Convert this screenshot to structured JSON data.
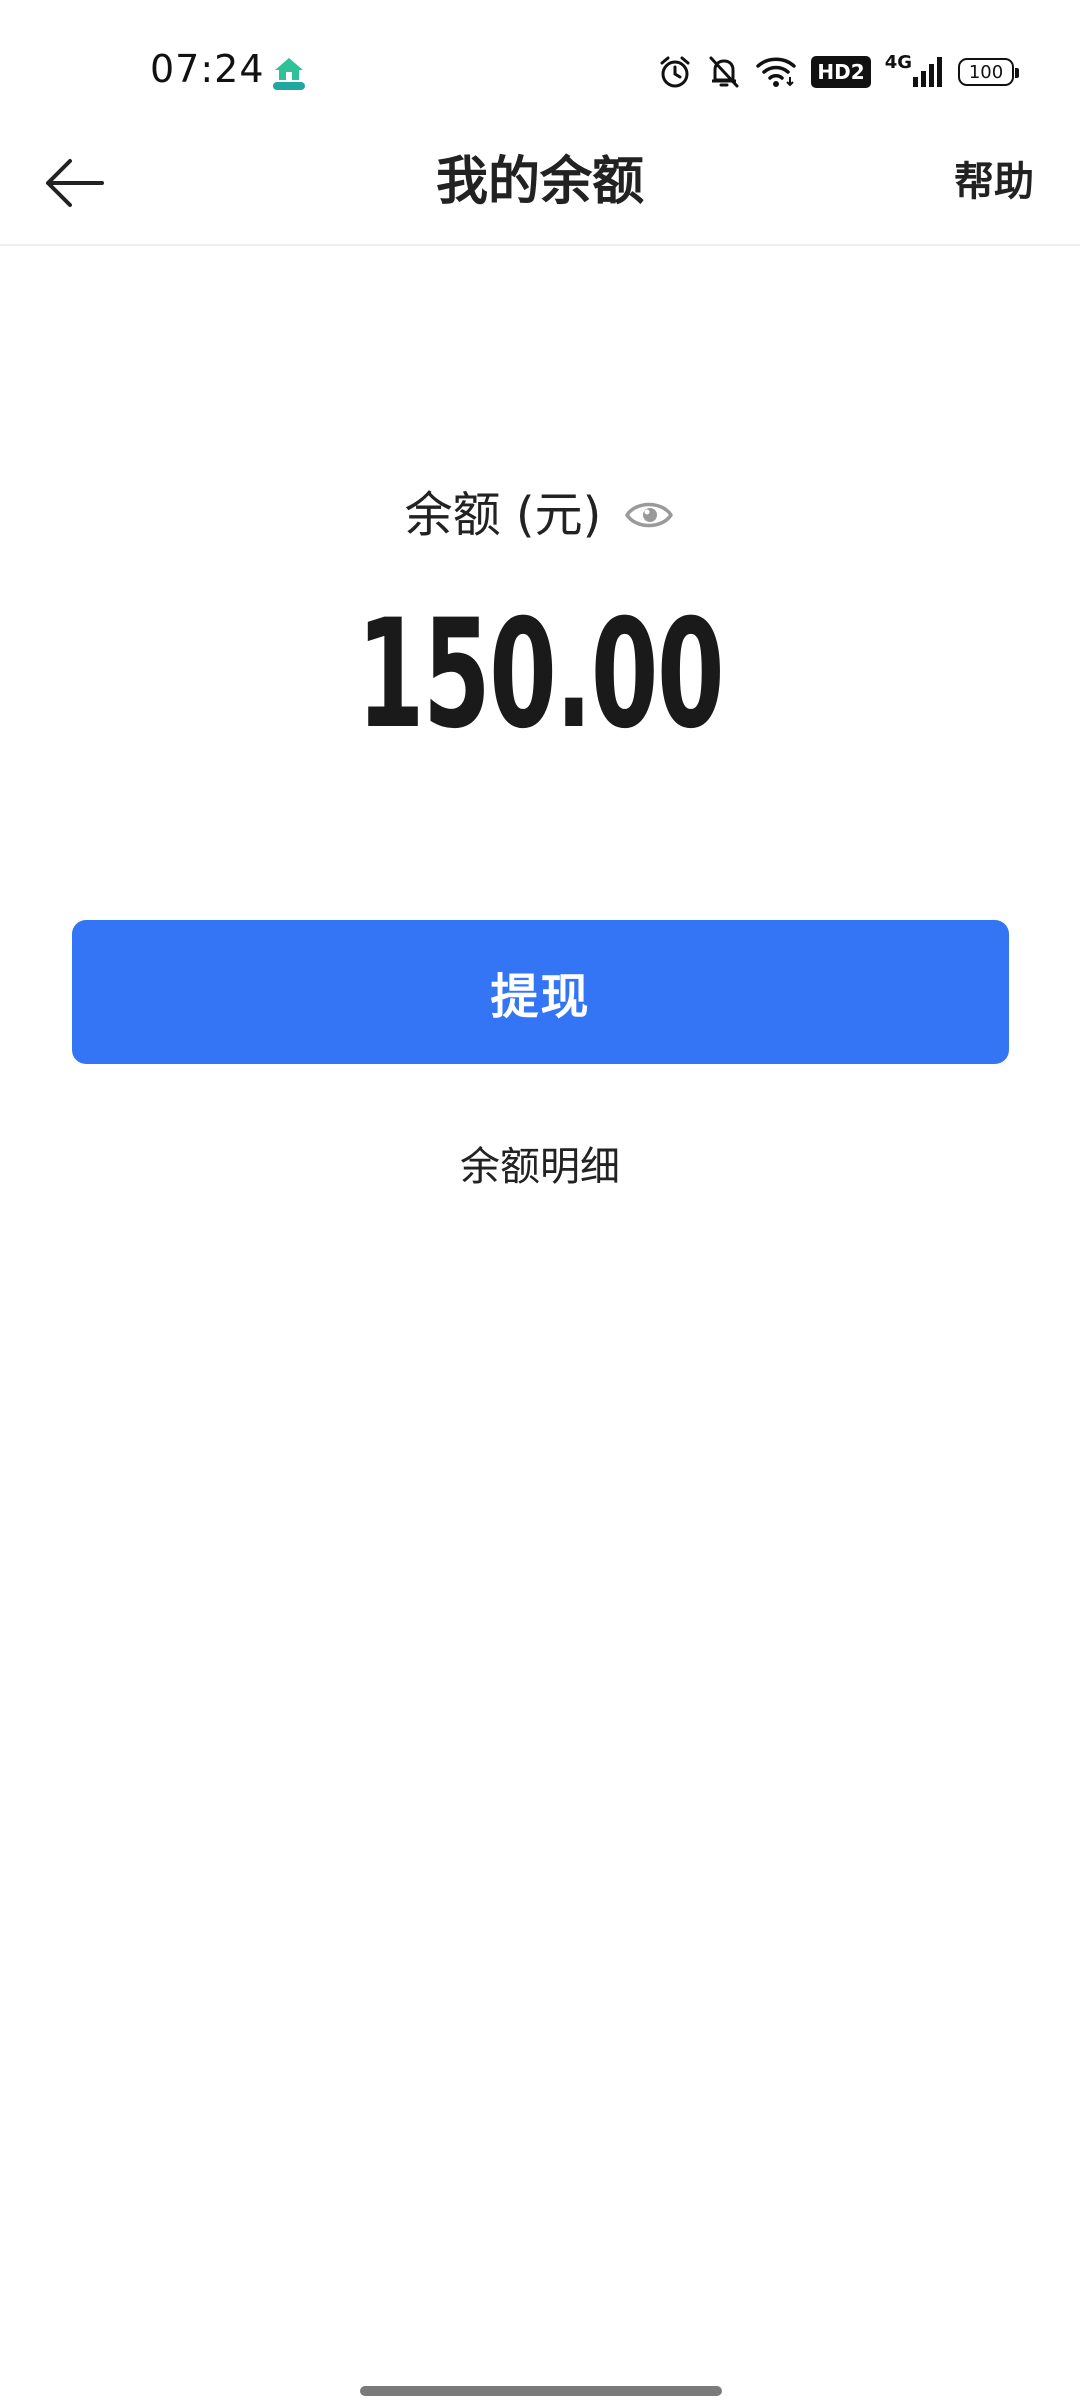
{
  "status_bar": {
    "time": "07:24",
    "hd_badge": "HD2",
    "network": "4G",
    "battery": "100"
  },
  "header": {
    "title": "我的余额",
    "help_label": "帮助"
  },
  "balance": {
    "label": "余额 (元)",
    "amount": "150.00"
  },
  "actions": {
    "withdraw_label": "提现",
    "details_label": "余额明细"
  },
  "colors": {
    "accent": "#3375f5",
    "text": "#222222",
    "muted_icon": "#9a9a9a"
  }
}
